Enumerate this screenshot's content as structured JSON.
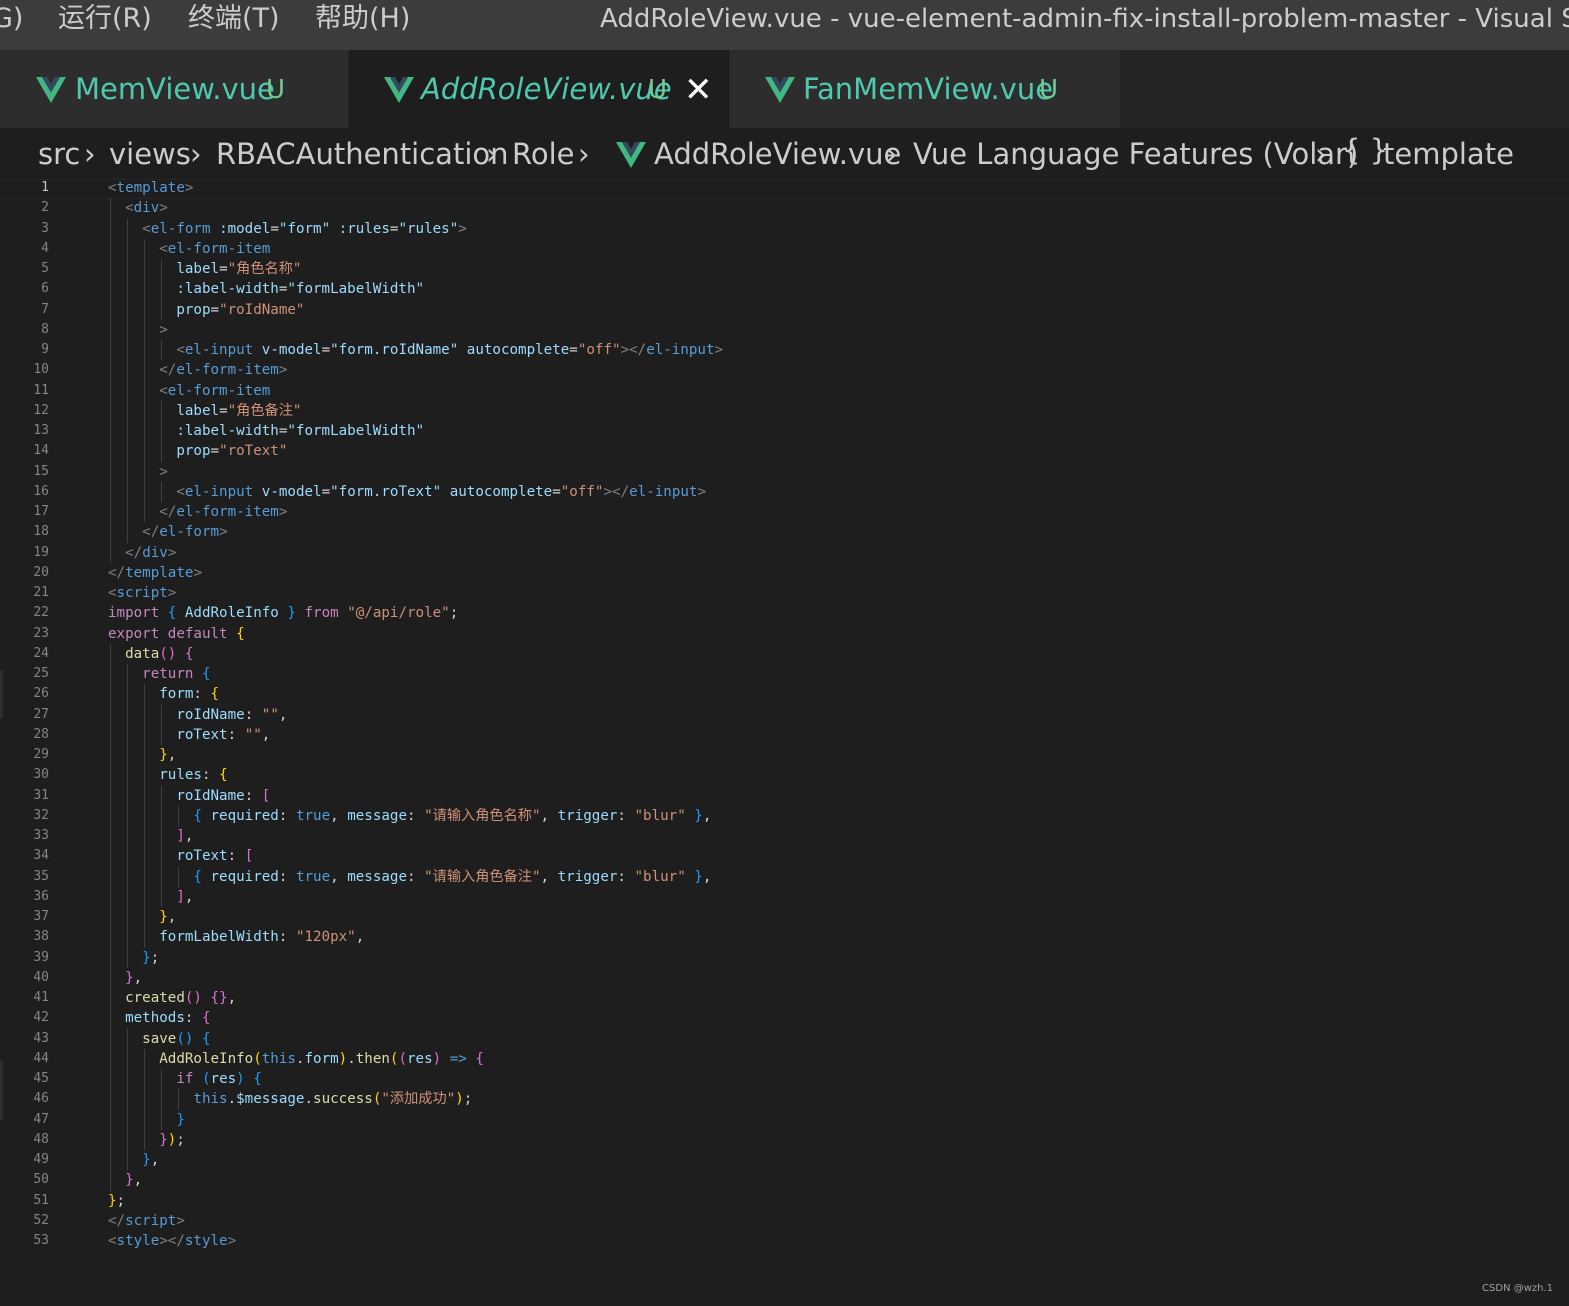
{
  "titlebar": {
    "menu": [
      "G)",
      "运行(R)",
      "终端(T)",
      "帮助(H)"
    ],
    "title": "AddRoleView.vue - vue-element-admin-fix-install-problem-master - Visual Studio"
  },
  "tabs": [
    {
      "name": "MemView.vue",
      "status": "U",
      "active": false
    },
    {
      "name": "AddRoleView.vue",
      "status": "U",
      "active": true,
      "close": "✕"
    },
    {
      "name": "FanMemView.vue",
      "status": "U",
      "active": false
    }
  ],
  "breadcrumb": [
    "src",
    "views",
    "RBACAuthentication",
    "Role",
    "AddRoleView.vue",
    "Vue Language Features (Volar)",
    "{ }",
    "template"
  ],
  "breadcrumb_separator": "›",
  "current_line": 1,
  "code_lines": [
    [
      [
        "<",
        "p"
      ],
      [
        "template",
        "t"
      ],
      [
        ">",
        "p"
      ]
    ],
    [
      [
        "  "
      ],
      [
        "<",
        "p"
      ],
      [
        "div",
        "t"
      ],
      [
        ">",
        "p"
      ]
    ],
    [
      [
        "    "
      ],
      [
        "<",
        "p"
      ],
      [
        "el-form",
        "t"
      ],
      [
        " "
      ],
      [
        ":model",
        "a"
      ],
      [
        "="
      ],
      [
        "\"form\"",
        "a"
      ],
      [
        " "
      ],
      [
        ":rules",
        "a"
      ],
      [
        "="
      ],
      [
        "\"rules\"",
        "a"
      ],
      [
        ">",
        "p"
      ]
    ],
    [
      [
        "      "
      ],
      [
        "<",
        "p"
      ],
      [
        "el-form-item",
        "t"
      ]
    ],
    [
      [
        "        "
      ],
      [
        "label",
        "a"
      ],
      [
        "="
      ],
      [
        "\"角色名称\"",
        "s"
      ]
    ],
    [
      [
        "        "
      ],
      [
        ":label-width",
        "a"
      ],
      [
        "="
      ],
      [
        "\"formLabelWidth\"",
        "a"
      ]
    ],
    [
      [
        "        "
      ],
      [
        "prop",
        "a"
      ],
      [
        "="
      ],
      [
        "\"roIdName\"",
        "s"
      ]
    ],
    [
      [
        "      "
      ],
      [
        ">",
        "p"
      ]
    ],
    [
      [
        "        "
      ],
      [
        "<",
        "p"
      ],
      [
        "el-input",
        "t"
      ],
      [
        " "
      ],
      [
        "v-model",
        "a"
      ],
      [
        "="
      ],
      [
        "\"form.roIdName\"",
        "a"
      ],
      [
        " "
      ],
      [
        "autocomplete",
        "a"
      ],
      [
        "="
      ],
      [
        "\"off\"",
        "s"
      ],
      [
        "></",
        "p"
      ],
      [
        "el-input",
        "t"
      ],
      [
        ">",
        "p"
      ]
    ],
    [
      [
        "      "
      ],
      [
        "</",
        "p"
      ],
      [
        "el-form-item",
        "t"
      ],
      [
        ">",
        "p"
      ]
    ],
    [
      [
        "      "
      ],
      [
        "<",
        "p"
      ],
      [
        "el-form-item",
        "t"
      ]
    ],
    [
      [
        "        "
      ],
      [
        "label",
        "a"
      ],
      [
        "="
      ],
      [
        "\"角色备注\"",
        "s"
      ]
    ],
    [
      [
        "        "
      ],
      [
        ":label-width",
        "a"
      ],
      [
        "="
      ],
      [
        "\"formLabelWidth\"",
        "a"
      ]
    ],
    [
      [
        "        "
      ],
      [
        "prop",
        "a"
      ],
      [
        "="
      ],
      [
        "\"roText\"",
        "s"
      ]
    ],
    [
      [
        "      "
      ],
      [
        ">",
        "p"
      ]
    ],
    [
      [
        "        "
      ],
      [
        "<",
        "p"
      ],
      [
        "el-input",
        "t"
      ],
      [
        " "
      ],
      [
        "v-model",
        "a"
      ],
      [
        "="
      ],
      [
        "\"form.roText\"",
        "a"
      ],
      [
        " "
      ],
      [
        "autocomplete",
        "a"
      ],
      [
        "="
      ],
      [
        "\"off\"",
        "s"
      ],
      [
        "></",
        "p"
      ],
      [
        "el-input",
        "t"
      ],
      [
        ">",
        "p"
      ]
    ],
    [
      [
        "      "
      ],
      [
        "</",
        "p"
      ],
      [
        "el-form-item",
        "t"
      ],
      [
        ">",
        "p"
      ]
    ],
    [
      [
        "    "
      ],
      [
        "</",
        "p"
      ],
      [
        "el-form",
        "t"
      ],
      [
        ">",
        "p"
      ]
    ],
    [
      [
        "  "
      ],
      [
        "</",
        "p"
      ],
      [
        "div",
        "t"
      ],
      [
        ">",
        "p"
      ]
    ],
    [
      [
        "</",
        "p"
      ],
      [
        "template",
        "t"
      ],
      [
        ">",
        "p"
      ]
    ],
    [
      [
        "<",
        "p"
      ],
      [
        "script",
        "t"
      ],
      [
        ">",
        "p"
      ]
    ],
    [
      [
        "import",
        "k"
      ],
      [
        " "
      ],
      [
        "{",
        "b3"
      ],
      [
        " "
      ],
      [
        "AddRoleInfo",
        "v"
      ],
      [
        " "
      ],
      [
        "}",
        "b3"
      ],
      [
        " "
      ],
      [
        "from",
        "k"
      ],
      [
        " "
      ],
      [
        "\"@/api/role\"",
        "s"
      ],
      [
        ";"
      ]
    ],
    [
      [
        "export",
        "k"
      ],
      [
        " "
      ],
      [
        "default",
        "k"
      ],
      [
        " "
      ],
      [
        "{",
        "b1"
      ]
    ],
    [
      [
        "  "
      ],
      [
        "data",
        "f"
      ],
      [
        "()",
        "b2"
      ],
      [
        " "
      ],
      [
        "{",
        "b2"
      ]
    ],
    [
      [
        "    "
      ],
      [
        "return",
        "k"
      ],
      [
        " "
      ],
      [
        "{",
        "b3"
      ]
    ],
    [
      [
        "      "
      ],
      [
        "form",
        "v"
      ],
      [
        ": "
      ],
      [
        "{",
        "b1"
      ]
    ],
    [
      [
        "        "
      ],
      [
        "roIdName",
        "v"
      ],
      [
        ": "
      ],
      [
        "\"\"",
        "s"
      ],
      [
        ","
      ]
    ],
    [
      [
        "        "
      ],
      [
        "roText",
        "v"
      ],
      [
        ": "
      ],
      [
        "\"\"",
        "s"
      ],
      [
        ","
      ]
    ],
    [
      [
        "      "
      ],
      [
        "}",
        "b1"
      ],
      [
        ","
      ]
    ],
    [
      [
        "      "
      ],
      [
        "rules",
        "v"
      ],
      [
        ": "
      ],
      [
        "{",
        "b1"
      ]
    ],
    [
      [
        "        "
      ],
      [
        "roIdName",
        "v"
      ],
      [
        ": "
      ],
      [
        "[",
        "b2"
      ]
    ],
    [
      [
        "          "
      ],
      [
        "{",
        "b3"
      ],
      [
        " "
      ],
      [
        "required",
        "v"
      ],
      [
        ": "
      ],
      [
        "true",
        "t"
      ],
      [
        ", "
      ],
      [
        "message",
        "v"
      ],
      [
        ": "
      ],
      [
        "\"请输入角色名称\"",
        "s"
      ],
      [
        ", "
      ],
      [
        "trigger",
        "v"
      ],
      [
        ": "
      ],
      [
        "\"blur\"",
        "s"
      ],
      [
        " "
      ],
      [
        "}",
        "b3"
      ],
      [
        ","
      ]
    ],
    [
      [
        "        "
      ],
      [
        "]",
        "b2"
      ],
      [
        ","
      ]
    ],
    [
      [
        "        "
      ],
      [
        "roText",
        "v"
      ],
      [
        ": "
      ],
      [
        "[",
        "b2"
      ]
    ],
    [
      [
        "          "
      ],
      [
        "{",
        "b3"
      ],
      [
        " "
      ],
      [
        "required",
        "v"
      ],
      [
        ": "
      ],
      [
        "true",
        "t"
      ],
      [
        ", "
      ],
      [
        "message",
        "v"
      ],
      [
        ": "
      ],
      [
        "\"请输入角色备注\"",
        "s"
      ],
      [
        ", "
      ],
      [
        "trigger",
        "v"
      ],
      [
        ": "
      ],
      [
        "\"blur\"",
        "s"
      ],
      [
        " "
      ],
      [
        "}",
        "b3"
      ],
      [
        ","
      ]
    ],
    [
      [
        "        "
      ],
      [
        "]",
        "b2"
      ],
      [
        ","
      ]
    ],
    [
      [
        "      "
      ],
      [
        "}",
        "b1"
      ],
      [
        ","
      ]
    ],
    [
      [
        "      "
      ],
      [
        "formLabelWidth",
        "v"
      ],
      [
        ": "
      ],
      [
        "\"120px\"",
        "s"
      ],
      [
        ","
      ]
    ],
    [
      [
        "    "
      ],
      [
        "}",
        "b3"
      ],
      [
        ";"
      ]
    ],
    [
      [
        "  "
      ],
      [
        "}",
        "b2"
      ],
      [
        ","
      ]
    ],
    [
      [
        "  "
      ],
      [
        "created",
        "f"
      ],
      [
        "()",
        "b2"
      ],
      [
        " "
      ],
      [
        "{}",
        "b2"
      ],
      [
        ","
      ]
    ],
    [
      [
        "  "
      ],
      [
        "methods",
        "v"
      ],
      [
        ": "
      ],
      [
        "{",
        "b2"
      ]
    ],
    [
      [
        "    "
      ],
      [
        "save",
        "f"
      ],
      [
        "()",
        "b3"
      ],
      [
        " "
      ],
      [
        "{",
        "b3"
      ]
    ],
    [
      [
        "      "
      ],
      [
        "AddRoleInfo",
        "f"
      ],
      [
        "(",
        "b1"
      ],
      [
        "this",
        "t"
      ],
      [
        "."
      ],
      [
        "form",
        "v"
      ],
      [
        ")",
        "b1"
      ],
      [
        "."
      ],
      [
        "then",
        "f"
      ],
      [
        "(",
        "b1"
      ],
      [
        "(",
        "b2"
      ],
      [
        "res",
        "v"
      ],
      [
        ")",
        "b2"
      ],
      [
        " "
      ],
      [
        "=>",
        "t"
      ],
      [
        " "
      ],
      [
        "{",
        "b2"
      ]
    ],
    [
      [
        "        "
      ],
      [
        "if",
        "k"
      ],
      [
        " "
      ],
      [
        "(",
        "b3"
      ],
      [
        "res",
        "v"
      ],
      [
        ")",
        "b3"
      ],
      [
        " "
      ],
      [
        "{",
        "b3"
      ]
    ],
    [
      [
        "          "
      ],
      [
        "this",
        "t"
      ],
      [
        "."
      ],
      [
        "$message",
        "v"
      ],
      [
        "."
      ],
      [
        "success",
        "f"
      ],
      [
        "(",
        "b1"
      ],
      [
        "\"添加成功\"",
        "s"
      ],
      [
        ")",
        "b1"
      ],
      [
        ";"
      ]
    ],
    [
      [
        "        "
      ],
      [
        "}",
        "b3"
      ]
    ],
    [
      [
        "      "
      ],
      [
        "}",
        "b2"
      ],
      [
        ")",
        "b1"
      ],
      [
        ";"
      ]
    ],
    [
      [
        "    "
      ],
      [
        "}",
        "b3"
      ],
      [
        ","
      ]
    ],
    [
      [
        "  "
      ],
      [
        "}",
        "b2"
      ],
      [
        ","
      ]
    ],
    [
      [
        "}",
        "b1"
      ],
      [
        ";"
      ]
    ],
    [
      [
        "</",
        "p"
      ],
      [
        "script",
        "t"
      ],
      [
        ">",
        "p"
      ]
    ],
    [
      [
        "<",
        "p"
      ],
      [
        "style",
        "t"
      ],
      [
        "></",
        "p"
      ],
      [
        "style",
        "t"
      ],
      [
        ">",
        "p"
      ]
    ]
  ],
  "watermark": "CSDN @wzh.1"
}
